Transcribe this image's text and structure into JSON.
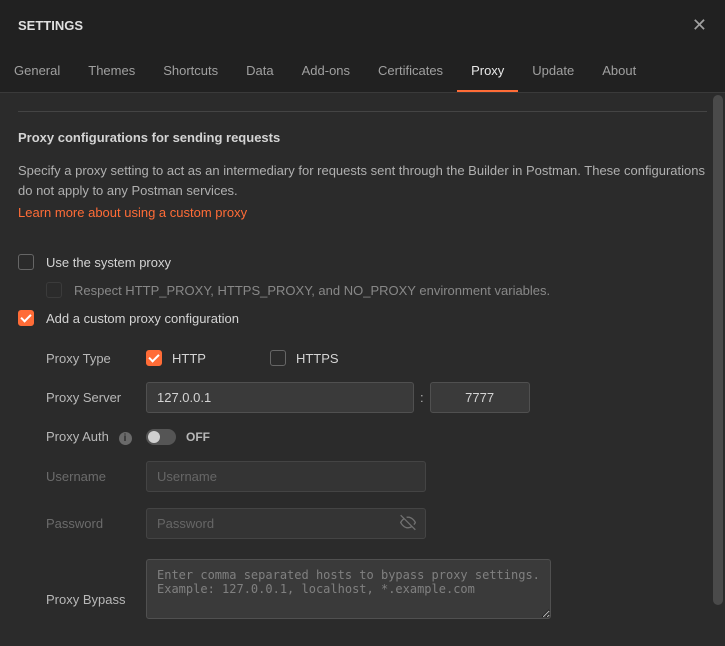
{
  "header": {
    "title": "SETTINGS"
  },
  "tabs": [
    {
      "label": "General",
      "active": false
    },
    {
      "label": "Themes",
      "active": false
    },
    {
      "label": "Shortcuts",
      "active": false
    },
    {
      "label": "Data",
      "active": false
    },
    {
      "label": "Add-ons",
      "active": false
    },
    {
      "label": "Certificates",
      "active": false
    },
    {
      "label": "Proxy",
      "active": true
    },
    {
      "label": "Update",
      "active": false
    },
    {
      "label": "About",
      "active": false
    }
  ],
  "proxy": {
    "section_title": "Proxy configurations for sending requests",
    "description": "Specify a proxy setting to act as an intermediary for requests sent through the Builder in Postman. These configurations do not apply to any Postman services.",
    "learn_more": "Learn more about using a custom proxy",
    "use_system_label": "Use the system proxy",
    "use_system_checked": false,
    "respect_env_label": "Respect HTTP_PROXY, HTTPS_PROXY, and NO_PROXY environment variables.",
    "respect_env_checked": false,
    "add_custom_label": "Add a custom proxy configuration",
    "add_custom_checked": true,
    "type_label": "Proxy Type",
    "http_label": "HTTP",
    "http_checked": true,
    "https_label": "HTTPS",
    "https_checked": false,
    "server_label": "Proxy Server",
    "host_value": "127.0.0.1",
    "port_value": "7777",
    "auth_label": "Proxy Auth",
    "auth_toggle_label": "OFF",
    "username_label": "Username",
    "username_placeholder": "Username",
    "username_value": "",
    "password_label": "Password",
    "password_placeholder": "Password",
    "password_value": "",
    "bypass_label": "Proxy Bypass",
    "bypass_placeholder": "Enter comma separated hosts to bypass proxy settings.\nExample: 127.0.0.1, localhost, *.example.com",
    "bypass_value": ""
  }
}
